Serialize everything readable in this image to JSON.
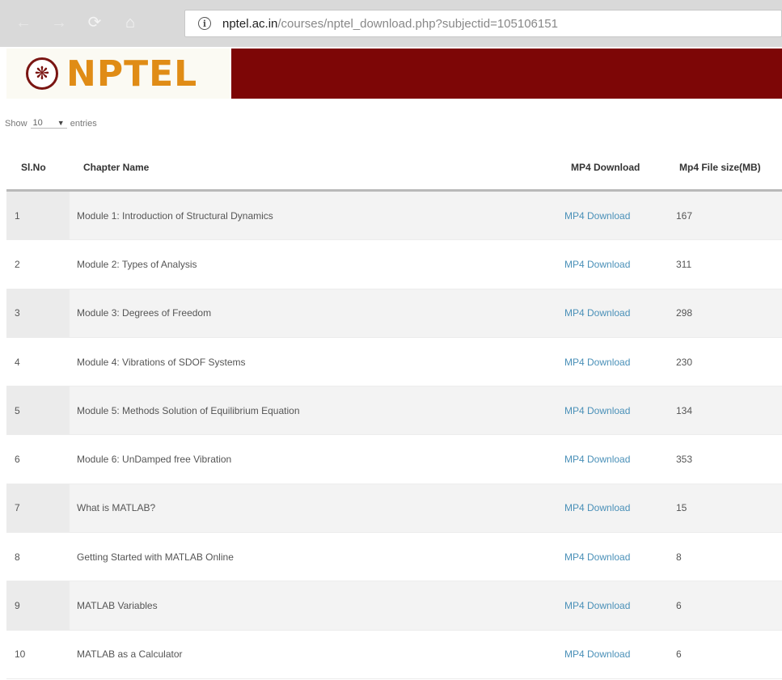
{
  "browser": {
    "url_host": "nptel.ac.in",
    "url_path": "/courses/nptel_download.php?subjectid=105106151"
  },
  "header": {
    "logo_text": "NPTEL",
    "brand_color": "#7d0606",
    "logo_color": "#e08c16"
  },
  "controls": {
    "show_label": "Show",
    "entries_value": "10",
    "entries_label": "entries"
  },
  "table": {
    "headers": {
      "sl_no": "Sl.No",
      "chapter": "Chapter Name",
      "download": "MP4 Download",
      "size": "Mp4 File size(MB)"
    },
    "rows": [
      {
        "no": "1",
        "chapter": "Module 1: Introduction of Structural Dynamics",
        "download": "MP4 Download",
        "size": "167"
      },
      {
        "no": "2",
        "chapter": "Module 2: Types of Analysis",
        "download": "MP4 Download",
        "size": "311"
      },
      {
        "no": "3",
        "chapter": "Module 3: Degrees of Freedom",
        "download": "MP4 Download",
        "size": "298"
      },
      {
        "no": "4",
        "chapter": "Module 4: Vibrations of SDOF Systems",
        "download": "MP4 Download",
        "size": "230"
      },
      {
        "no": "5",
        "chapter": "Module 5: Methods Solution of Equilibrium Equation",
        "download": "MP4 Download",
        "size": "134"
      },
      {
        "no": "6",
        "chapter": "Module 6: UnDamped free Vibration",
        "download": "MP4 Download",
        "size": "353"
      },
      {
        "no": "7",
        "chapter": "What is MATLAB?",
        "download": "MP4 Download",
        "size": "15"
      },
      {
        "no": "8",
        "chapter": "Getting Started with MATLAB Online",
        "download": "MP4 Download",
        "size": "8"
      },
      {
        "no": "9",
        "chapter": "MATLAB Variables",
        "download": "MP4 Download",
        "size": "6"
      },
      {
        "no": "10",
        "chapter": "MATLAB as a Calculator",
        "download": "MP4 Download",
        "size": "6"
      }
    ]
  }
}
